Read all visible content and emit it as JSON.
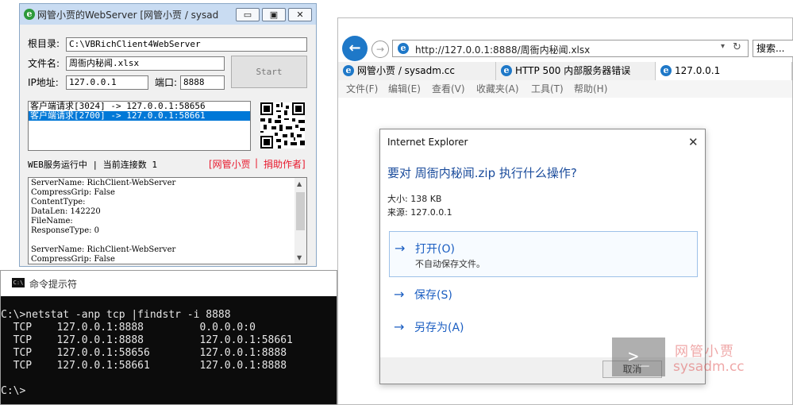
{
  "webserver": {
    "title": "网管小贾的WebServer [网管小贾 / sysad",
    "caption": {
      "minimize": "▭",
      "restore": "▣",
      "close": "✕"
    },
    "root_label": "根目录:",
    "root_value": "C:\\VBRichClient4WebServer",
    "file_label": "文件名:",
    "file_value": "周衙内秘闻.xlsx",
    "ip_label": "IP地址:",
    "ip_value": "127.0.0.1",
    "port_label": "端口:",
    "port_value": "8888",
    "start_label": "Start",
    "requests": [
      "客户端请求[3024] -> 127.0.0.1:58656",
      "客户端请求[2700] -> 127.0.0.1:58661"
    ],
    "status_text": "WEB服务运行中 | 当前连接数 1",
    "link_author": "[网管小贾",
    "link_sep": "|",
    "link_donate": "捐助作者]",
    "log_lines": [
      "ServerName: RichClient-WebServer",
      "CompressGrip: False",
      "ContentType:",
      "DataLen: 142220",
      "FileName:",
      "ResponseType: 0",
      "",
      "ServerName: RichClient-WebServer",
      "CompressGrip: False"
    ]
  },
  "cmd": {
    "title": "命令提示符",
    "icon_text": "C:\\",
    "lines": [
      "C:\\>netstat -anp tcp |findstr -i 8888",
      "  TCP    127.0.0.1:8888         0.0.0.0:0",
      "  TCP    127.0.0.1:8888         127.0.0.1:58661",
      "  TCP    127.0.0.1:58656        127.0.0.1:8888",
      "  TCP    127.0.0.1:58661        127.0.0.1:8888",
      "",
      "C:\\>"
    ]
  },
  "ie": {
    "address": "http://127.0.0.1:8888/周衙内秘闻.xlsx",
    "refresh_icon": "↻",
    "search_label": "搜索...",
    "tabs": [
      "网管小贾 / sysadm.cc",
      "HTTP 500 内部服务器错误",
      "127.0.0.1"
    ],
    "menu": [
      "文件(F)",
      "编辑(E)",
      "查看(V)",
      "收藏夹(A)",
      "工具(T)",
      "帮助(H)"
    ]
  },
  "dialog": {
    "title": "Internet Explorer",
    "close": "✕",
    "question": "要对 周衙内秘闻.zip 执行什么操作?",
    "size_text": "大小: 138 KB",
    "source_text": "来源: 127.0.0.1",
    "arrow": "→",
    "open_label": "打开(O)",
    "open_desc": "不自动保存文件。",
    "save_label": "保存(S)",
    "saveas_label": "另存为(A)",
    "cancel_label": "取消"
  },
  "watermark": {
    "logo_text": ">_",
    "name": "网管小贾",
    "site": "sysadm.cc"
  },
  "colors": {
    "accent_blue": "#0078d7",
    "link_red": "#e8182c",
    "dialog_blue": "#1b5ec2"
  }
}
